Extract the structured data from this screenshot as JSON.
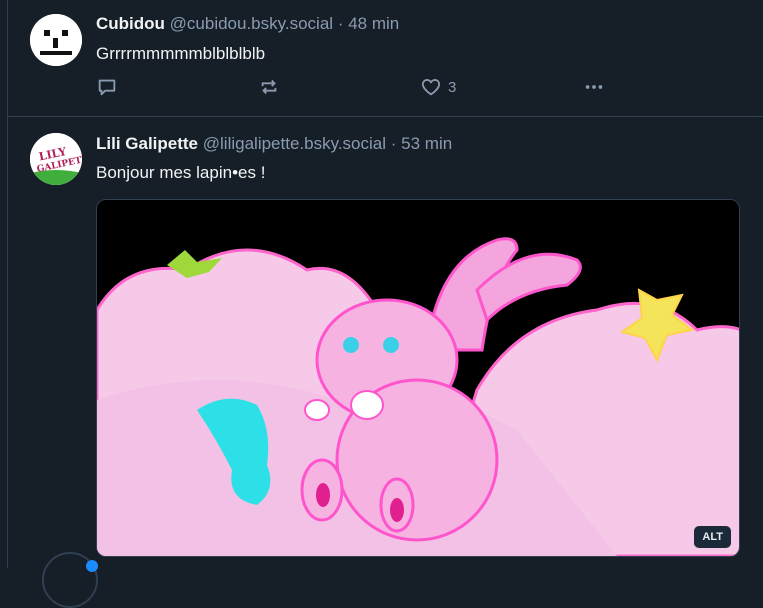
{
  "posts": [
    {
      "name": "Cubidou",
      "handle": "@cubidou.bsky.social",
      "separator": "·",
      "time": "48 min",
      "text": "Grrrrmmmmmblblblblb",
      "actions": {
        "reply_icon": "reply-icon",
        "repost_icon": "repost-icon",
        "like_icon": "heart-icon",
        "like_count": "3",
        "more_icon": "more-icon"
      }
    },
    {
      "name": "Lili Galipette",
      "handle": "@liligalipette.bsky.social",
      "separator": "·",
      "time": "53 min",
      "text": "Bonjour mes lapin•es !",
      "media": {
        "alt_badge": "ALT"
      }
    }
  ],
  "colors": {
    "background": "#161e27",
    "border": "#2e4052",
    "muted": "#8a9bb0",
    "accent": "#1b8cff"
  }
}
